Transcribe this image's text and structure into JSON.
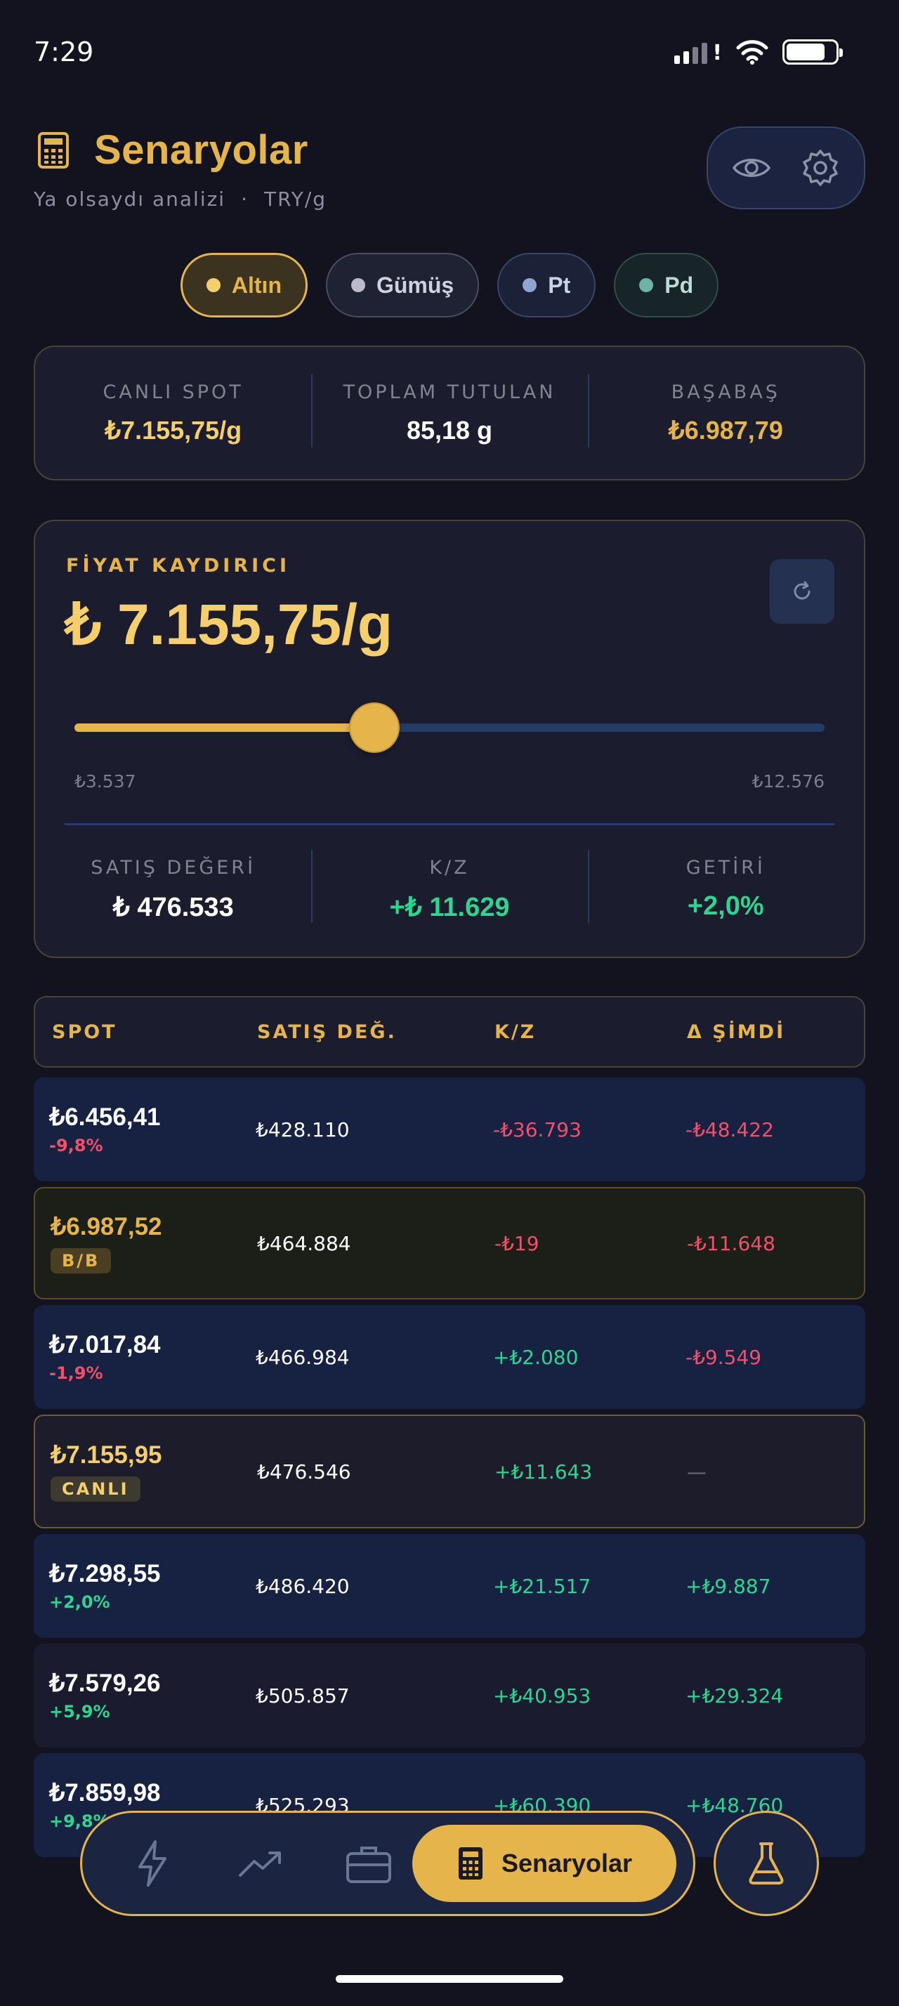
{
  "status_bar": {
    "time": "7:29"
  },
  "header": {
    "title": "Senaryolar",
    "subtitle": "Ya olsaydı analizi",
    "separator": "·",
    "unit": "TRY/g",
    "icons": [
      "calculator-icon",
      "eye-icon",
      "gear-icon"
    ]
  },
  "metals": [
    {
      "label": "Altın",
      "dot_color": "#f4cf6b",
      "selected": true
    },
    {
      "label": "Gümüş",
      "dot_color": "#b9bcc8",
      "selected": false
    },
    {
      "label": "Pt",
      "dot_color": "#8fa4cf",
      "selected": false
    },
    {
      "label": "Pd",
      "dot_color": "#6cb3a8",
      "selected": false
    }
  ],
  "summary": {
    "live_spot_label": "CANLI SPOT",
    "live_spot_value": "₺7.155,75/g",
    "total_held_label": "TOPLAM TUTULAN",
    "total_held_value": "85,18 g",
    "breakeven_label": "BAŞABAŞ",
    "breakeven_value": "₺6.987,79"
  },
  "slider": {
    "label": "FİYAT KAYDIRICI",
    "price": "₺ 7.155,75/g",
    "min_label": "₺3.537",
    "max_label": "₺12.576",
    "position_fraction": 0.4,
    "sale_value_label": "SATIŞ DEĞERİ",
    "sale_value": "₺ 476.533",
    "pl_label": "K/Z",
    "pl_value": "+₺ 11.629",
    "return_label": "GETİRİ",
    "return_value": "+2,0%"
  },
  "table": {
    "headers": [
      "SPOT",
      "SATIŞ DEĞ.",
      "K/Z",
      "Δ ŞİMDİ"
    ],
    "rows": [
      {
        "spot": "₺6.456,41",
        "pct": "-9,8%",
        "sale": "₺428.110",
        "pl": "-₺36.793",
        "delta": "-₺48.422"
      },
      {
        "spot": "₺6.987,52",
        "badge": "B/B",
        "sale": "₺464.884",
        "pl": "-₺19",
        "delta": "-₺11.648"
      },
      {
        "spot": "₺7.017,84",
        "pct": "-1,9%",
        "sale": "₺466.984",
        "pl": "+₺2.080",
        "delta": "-₺9.549"
      },
      {
        "spot": "₺7.155,95",
        "badge": "CANLI",
        "sale": "₺476.546",
        "pl": "+₺11.643",
        "delta": "—"
      },
      {
        "spot": "₺7.298,55",
        "pct": "+2,0%",
        "sale": "₺486.420",
        "pl": "+₺21.517",
        "delta": "+₺9.887"
      },
      {
        "spot": "₺7.579,26",
        "pct": "+5,9%",
        "sale": "₺505.857",
        "pl": "+₺40.953",
        "delta": "+₺29.324"
      },
      {
        "spot": "₺7.859,98",
        "pct": "+9,8%",
        "sale": "₺525.293",
        "pl": "+₺60.390",
        "delta": "+₺48.760"
      }
    ]
  },
  "nav": {
    "items": [
      "lightning-icon",
      "trend-icon",
      "briefcase-icon",
      "calculator-icon"
    ],
    "active_label": "Senaryolar",
    "lab_icon": "flask-icon"
  }
}
